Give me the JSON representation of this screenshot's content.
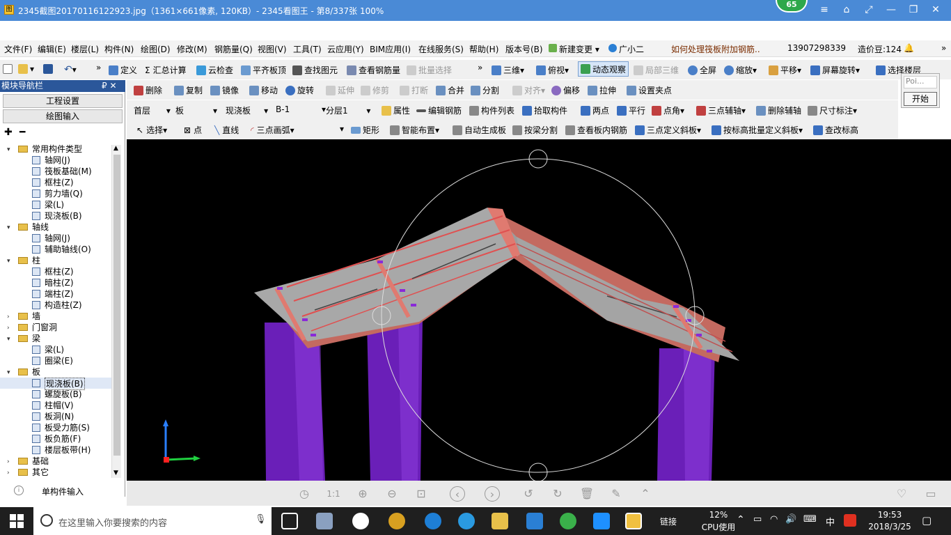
{
  "window": {
    "title": "2345截图20170116122923.jpg（1361×661像素, 120KB）- 2345看图王 - 第8/337张 100%",
    "badge": "65",
    "controls": [
      "≡",
      "⌂",
      "⤢",
      "—",
      "❐",
      "✕"
    ]
  },
  "menu": [
    "文件(F)",
    "编辑(E)",
    "楼层(L)",
    "构件(N)",
    "绘图(D)",
    "修改(M)",
    "钢筋量(Q)",
    "视图(V)",
    "工具(T)",
    "云应用(Y)",
    "BIM应用(I)",
    "在线服务(S)",
    "帮助(H)",
    "版本号(B)",
    "新建变更",
    "广小二",
    "如何处理筏板附加钢筋..",
    "13907298339",
    "造价豆:124"
  ],
  "toolbar1": [
    "定义",
    "汇总计算",
    "云检查",
    "平齐板顶",
    "查找图元",
    "查看钢筋量",
    "批量选择",
    "三维",
    "俯视",
    "动态观察",
    "局部三维",
    "全屏",
    "缩放",
    "平移",
    "屏幕旋转",
    "选择楼层"
  ],
  "toolbar2": [
    "删除",
    "复制",
    "镜像",
    "移动",
    "旋转",
    "延伸",
    "修剪",
    "打断",
    "合并",
    "分割",
    "对齐",
    "偏移",
    "拉伸",
    "设置夹点"
  ],
  "toolbar3": [
    "首层",
    "板",
    "现浇板",
    "B-1",
    "分层1",
    "属性",
    "编辑钢筋",
    "构件列表",
    "拾取构件",
    "两点",
    "平行",
    "点角",
    "三点辅轴",
    "删除辅轴",
    "尺寸标注"
  ],
  "toolbar4": [
    "选择",
    "点",
    "直线",
    "三点画弧",
    "矩形",
    "智能布置",
    "自动生成板",
    "按梁分割",
    "查看板内钢筋",
    "三点定义斜板",
    "按标高批量定义斜板",
    "查改标高"
  ],
  "left_panel": {
    "header": "模块导航栏",
    "pin": "₽ ✕",
    "btn_project": "工程设置",
    "btn_draw": "绘图输入",
    "footer": "单构件输入",
    "tree": [
      {
        "lvl": 0,
        "label": "常用构件类型",
        "open": true
      },
      {
        "lvl": 1,
        "label": "轴网(J)"
      },
      {
        "lvl": 1,
        "label": "筏板基础(M)"
      },
      {
        "lvl": 1,
        "label": "框柱(Z)"
      },
      {
        "lvl": 1,
        "label": "剪力墙(Q)"
      },
      {
        "lvl": 1,
        "label": "梁(L)"
      },
      {
        "lvl": 1,
        "label": "现浇板(B)"
      },
      {
        "lvl": 0,
        "label": "轴线",
        "open": true
      },
      {
        "lvl": 1,
        "label": "轴网(J)"
      },
      {
        "lvl": 1,
        "label": "辅助轴线(O)"
      },
      {
        "lvl": 0,
        "label": "柱",
        "open": true
      },
      {
        "lvl": 1,
        "label": "框柱(Z)"
      },
      {
        "lvl": 1,
        "label": "暗柱(Z)"
      },
      {
        "lvl": 1,
        "label": "端柱(Z)"
      },
      {
        "lvl": 1,
        "label": "构造柱(Z)"
      },
      {
        "lvl": 0,
        "label": "墙",
        "open": false
      },
      {
        "lvl": 0,
        "label": "门窗洞",
        "open": false
      },
      {
        "lvl": 0,
        "label": "梁",
        "open": true
      },
      {
        "lvl": 1,
        "label": "梁(L)"
      },
      {
        "lvl": 1,
        "label": "圈梁(E)"
      },
      {
        "lvl": 0,
        "label": "板",
        "open": true
      },
      {
        "lvl": 1,
        "label": "现浇板(B)",
        "selected": true
      },
      {
        "lvl": 1,
        "label": "螺旋板(B)"
      },
      {
        "lvl": 1,
        "label": "柱帽(V)"
      },
      {
        "lvl": 1,
        "label": "板洞(N)"
      },
      {
        "lvl": 1,
        "label": "板受力筋(S)"
      },
      {
        "lvl": 1,
        "label": "板负筋(F)"
      },
      {
        "lvl": 1,
        "label": "楼层板带(H)"
      },
      {
        "lvl": 0,
        "label": "基础",
        "open": false
      },
      {
        "lvl": 0,
        "label": "其它",
        "open": false
      }
    ]
  },
  "popup": {
    "text": "Poi...",
    "button": "开始"
  },
  "taskbar": {
    "search": "在这里输入你要搜索的内容",
    "link": "链接",
    "cpu": "12%",
    "cpu_label": "CPU使用",
    "ime": "中",
    "time": "19:53",
    "date": "2018/3/25"
  },
  "colors": {
    "titlebar": "#4a8ad6",
    "viewport": "#000000",
    "column": "#6a1fb8",
    "slab": "#a8a8a8",
    "beam": "#d9776b"
  }
}
